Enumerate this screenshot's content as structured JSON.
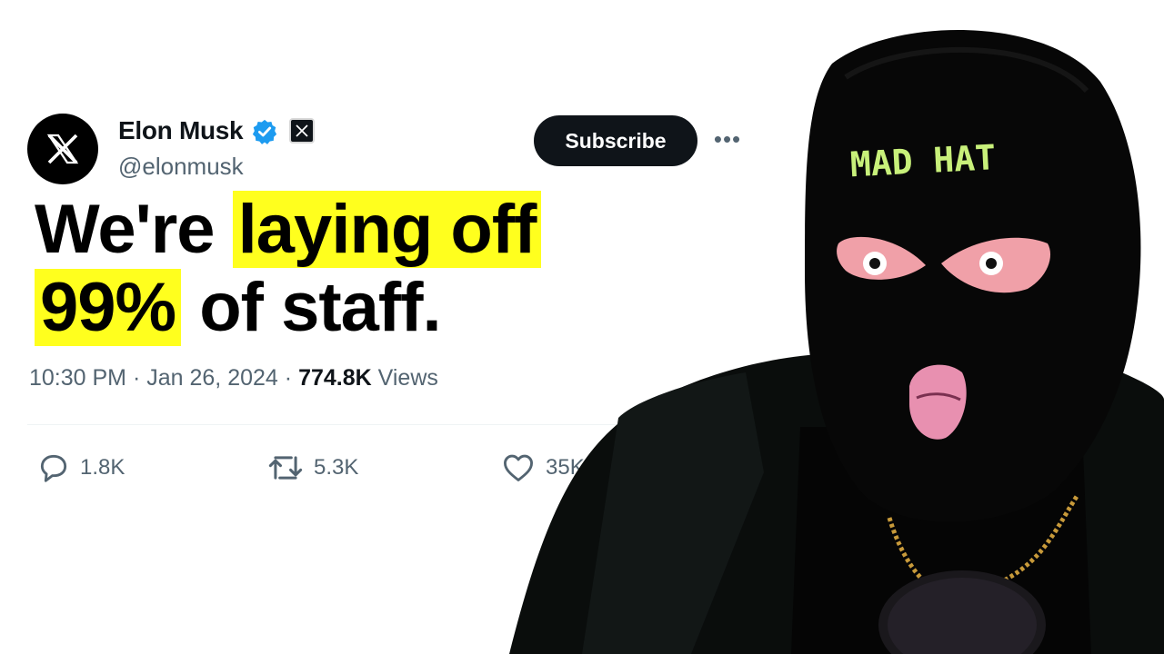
{
  "tweet": {
    "author_name": "Elon Musk",
    "handle": "@elonmusk",
    "subscribe_label": "Subscribe",
    "more_label": "•••",
    "headline_part1": "We're ",
    "headline_hl1": "laying off",
    "headline_hl2": "99%",
    "headline_part2": " of staff.",
    "time": "10:30 PM",
    "sep": "·",
    "date": "Jan 26, 2024",
    "views_count": "774.8K",
    "views_label": "Views",
    "replies": "1.8K",
    "reposts": "5.3K",
    "likes": "35K"
  },
  "icons": {
    "avatar": "x-logo-icon",
    "verified": "verified-badge-icon",
    "xbadge": "x-affiliation-icon",
    "reply": "reply-icon",
    "repost": "repost-icon",
    "like": "heart-icon"
  },
  "mask_text": "MAD HAT",
  "colors": {
    "highlight": "#ffff1e",
    "verified": "#1d9bf0",
    "mask": "#070707",
    "mask_text": "#c8f07a",
    "skin": "#f0a0a8"
  }
}
